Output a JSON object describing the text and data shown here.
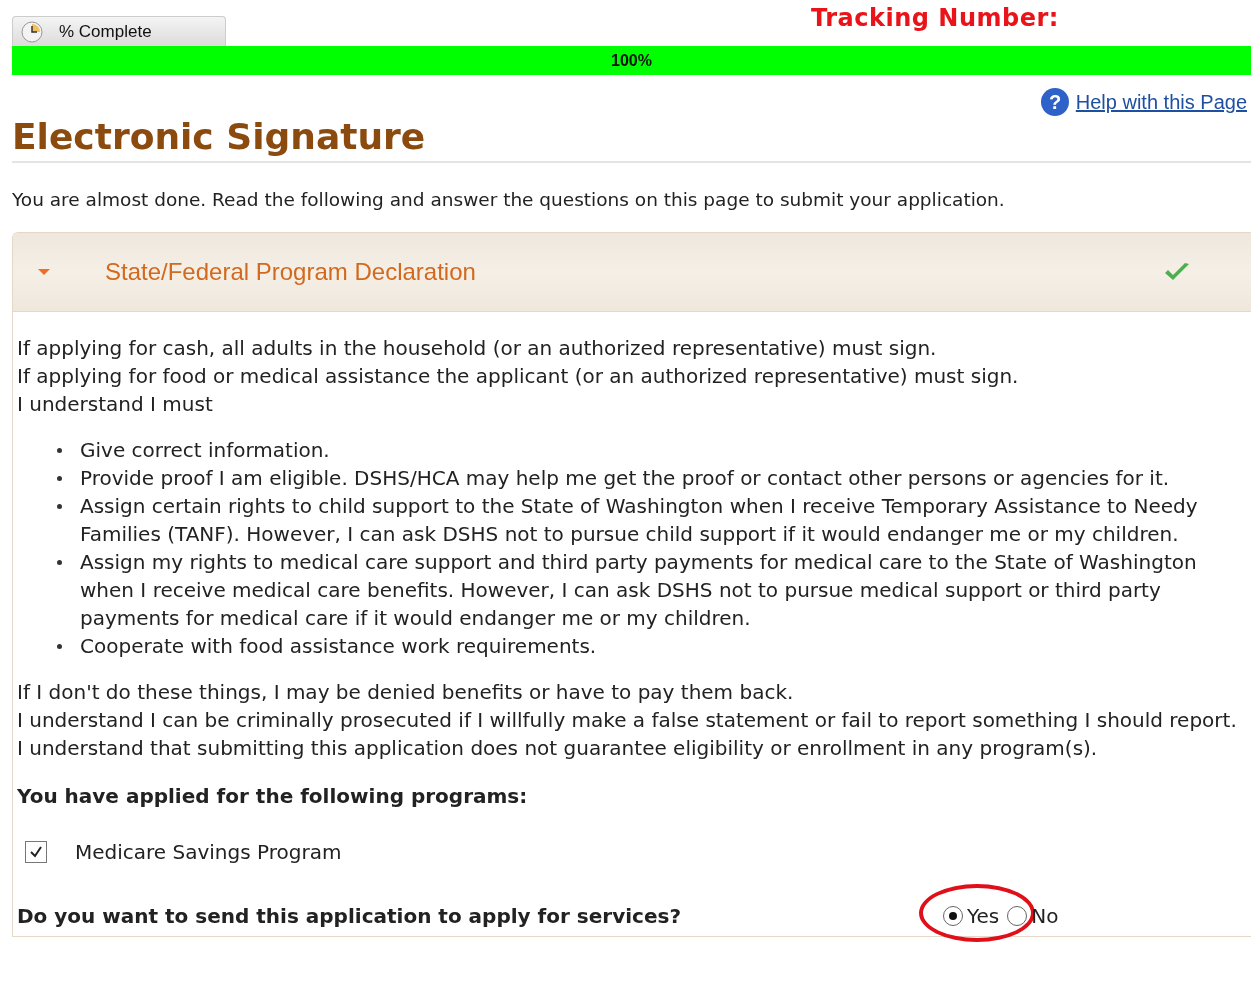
{
  "progress": {
    "tab_label": "% Complete",
    "level": 1,
    "reading": "100%"
  },
  "tracking_label": "Tracking Number:",
  "help_icon": "?",
  "help_link": "Help with this Page",
  "title": "Electronic Signature",
  "intro": "You are almost done. Read the following and answer the questions on this page to submit your application.",
  "panel": {
    "title": "State/Federal Program Declaration",
    "expanded": true,
    "complete": true,
    "lead": [
      "If applying for cash, all adults in the household (or an authorized representative) must sign.",
      "If applying for food or medical assistance the applicant (or an authorized representative) must sign.",
      "I understand I must"
    ],
    "bullets": [
      "Give correct information.",
      "Provide proof I am eligible. DSHS/HCA may help me get the proof or contact other persons or agencies for it.",
      "Assign certain rights to child support to the State of Washington when I receive Temporary Assistance to Needy Families (TANF). However, I can ask DSHS not to pursue child support if it would endanger me or my children.",
      "Assign my rights to medical care support and third party payments for medical care to the State of Washington when I receive medical care benefits. However, I can ask DSHS not to pursue medical support or third party payments for medical care if it would endanger me or my children.",
      "Cooperate with food assistance work requirements."
    ],
    "after": [
      "If I don't do these things, I may be denied benefits or have to pay them back.",
      "I understand I can be criminally prosecuted if I willfully make a false statement or fail to report something I should report.",
      "I understand that submitting this application does not guarantee eligibility or enrollment in any program(s)."
    ],
    "programs_heading": "You have applied for the following programs:",
    "programs": [
      {
        "label": "Medicare Savings Program",
        "checked": true
      }
    ],
    "question": "Do you want to send this application to apply for services?",
    "options": [
      {
        "label": "Yes",
        "selected": true,
        "circled": true
      },
      {
        "label": "No",
        "selected": false,
        "circled": false
      }
    ]
  }
}
